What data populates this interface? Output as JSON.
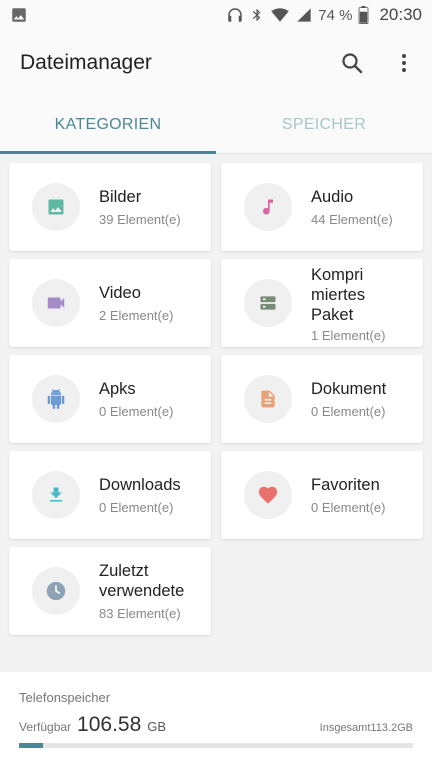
{
  "status_bar": {
    "battery": "74 %",
    "time": "20:30"
  },
  "app": {
    "title": "Dateimanager"
  },
  "tabs": [
    {
      "label": "KATEGORIEN",
      "active": true
    },
    {
      "label": "SPEICHER",
      "active": false
    }
  ],
  "categories": [
    {
      "name": "Bilder",
      "count": "39 Element(e)",
      "icon": "image-icon",
      "color": "#5fb8a5"
    },
    {
      "name": "Audio",
      "count": "44 Element(e)",
      "icon": "music-note-icon",
      "color": "#d9689e"
    },
    {
      "name": "Video",
      "count": "2 Element(e)",
      "icon": "video-camera-icon",
      "color": "#a68bc9"
    },
    {
      "name": "Kompri miertes Paket",
      "count": "1 Element(e)",
      "icon": "archive-icon",
      "color": "#7a8a78"
    },
    {
      "name": "Apks",
      "count": "0 Element(e)",
      "icon": "android-icon",
      "color": "#6a9ad9"
    },
    {
      "name": "Dokument",
      "count": "0 Element(e)",
      "icon": "document-icon",
      "color": "#e8a277"
    },
    {
      "name": "Downloads",
      "count": "0 Element(e)",
      "icon": "download-icon",
      "color": "#4fb9c9"
    },
    {
      "name": "Favoriten",
      "count": "0 Element(e)",
      "icon": "heart-icon",
      "color": "#e9706c"
    },
    {
      "name": "Zuletzt verwendete",
      "count": "83 Element(e)",
      "icon": "clock-icon",
      "color": "#8ea2b5"
    }
  ],
  "storage": {
    "label": "Telefonspeicher",
    "available_label": "Verfügbar",
    "available_value": "106.58",
    "available_unit": "GB",
    "total": "Insgesamt113.2GB",
    "used_fraction": 0.06
  },
  "colors": {
    "accent": "#4a8796"
  }
}
